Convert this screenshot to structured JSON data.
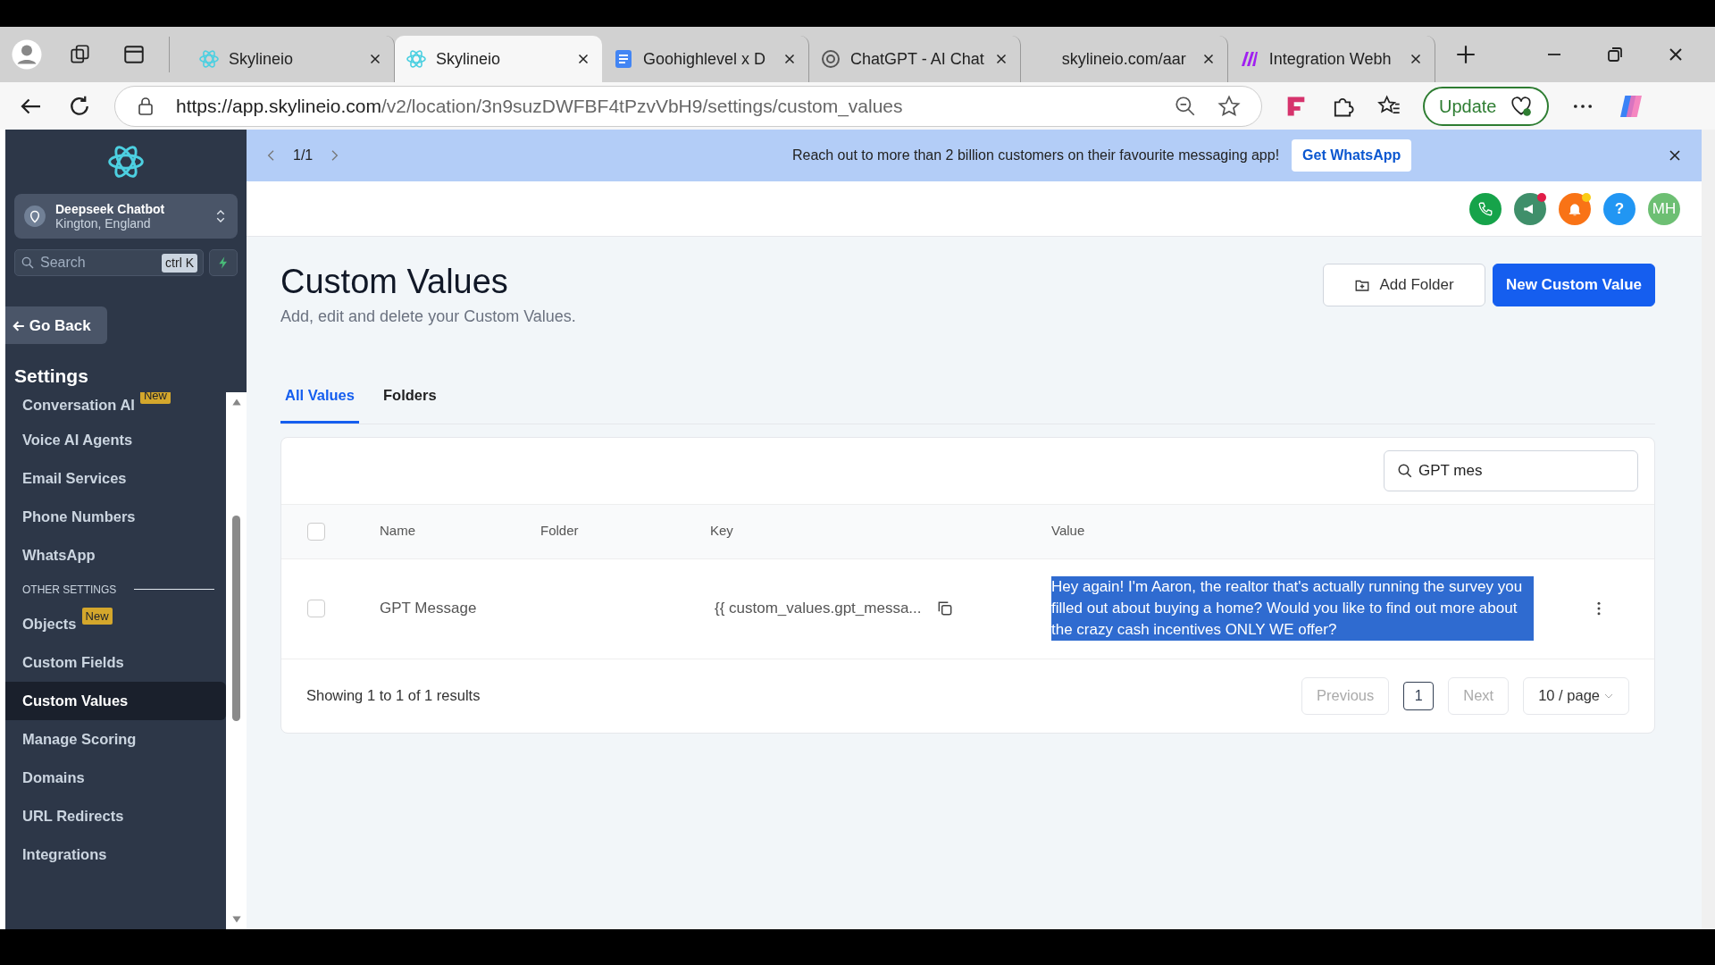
{
  "browser": {
    "tabs": [
      {
        "title": "Skylineio",
        "selected": false
      },
      {
        "title": "Skylineio",
        "selected": true
      },
      {
        "title": "Goohighlevel x D",
        "selected": false
      },
      {
        "title": "ChatGPT - AI Chat",
        "selected": false
      },
      {
        "title": "skylineio.com/aar",
        "selected": false
      },
      {
        "title": "Integration Webh",
        "selected": false
      }
    ],
    "url_host": "https://app.skylineio.com",
    "url_path": "/v2/location/3n9suzDWFBF4tPzvVbH9/settings/custom_values",
    "update_label": "Update"
  },
  "banner": {
    "pager": "1/1",
    "message": "Reach out to more than 2 billion customers on their favourite messaging app!",
    "button": "Get WhatsApp"
  },
  "header": {
    "help_label": "?",
    "avatar_initials": "MH"
  },
  "sidebar": {
    "account_name": "Deepseek Chatbot",
    "account_location": "Kington, England",
    "search_placeholder": "Search",
    "shortcut": "ctrl K",
    "go_back": "Go Back",
    "section_title": "Settings",
    "items": [
      {
        "kind": "item",
        "label": "Conversation AI",
        "badge": "New",
        "selected": false
      },
      {
        "kind": "item",
        "label": "Voice AI Agents",
        "selected": false
      },
      {
        "kind": "item",
        "label": "Email Services",
        "selected": false
      },
      {
        "kind": "item",
        "label": "Phone Numbers",
        "selected": false
      },
      {
        "kind": "item",
        "label": "WhatsApp",
        "selected": false
      },
      {
        "kind": "heading",
        "label": "OTHER SETTINGS"
      },
      {
        "kind": "item",
        "label": "Objects",
        "badge": "New",
        "selected": false
      },
      {
        "kind": "item",
        "label": "Custom Fields",
        "selected": false
      },
      {
        "kind": "item",
        "label": "Custom Values",
        "selected": true
      },
      {
        "kind": "item",
        "label": "Manage Scoring",
        "selected": false
      },
      {
        "kind": "item",
        "label": "Domains",
        "selected": false
      },
      {
        "kind": "item",
        "label": "URL Redirects",
        "selected": false
      },
      {
        "kind": "item",
        "label": "Integrations",
        "selected": false
      }
    ]
  },
  "page": {
    "title": "Custom Values",
    "subtitle": "Add, edit and delete your Custom Values.",
    "add_folder": "Add Folder",
    "new_value": "New Custom Value",
    "tabs": [
      {
        "label": "All Values",
        "selected": true
      },
      {
        "label": "Folders",
        "selected": false
      }
    ],
    "search_value": "GPT mes",
    "select_all_checked": false,
    "columns": [
      "Name",
      "Folder",
      "Key",
      "Value"
    ],
    "rows": [
      {
        "checked": false,
        "name": "GPT Message",
        "key": "{{ custom_values.gpt_messa...",
        "value": "Hey again! I'm Aaron, the realtor that's actually running the survey you filled out about buying a home? Would you like to find out more about the crazy cash incentives ONLY WE offer?",
        "value_highlighted": true
      }
    ],
    "summary": "Showing 1 to 1 of 1 results",
    "previous": "Previous",
    "page_number": "1",
    "next": "Next",
    "per_page": "10 / page"
  }
}
